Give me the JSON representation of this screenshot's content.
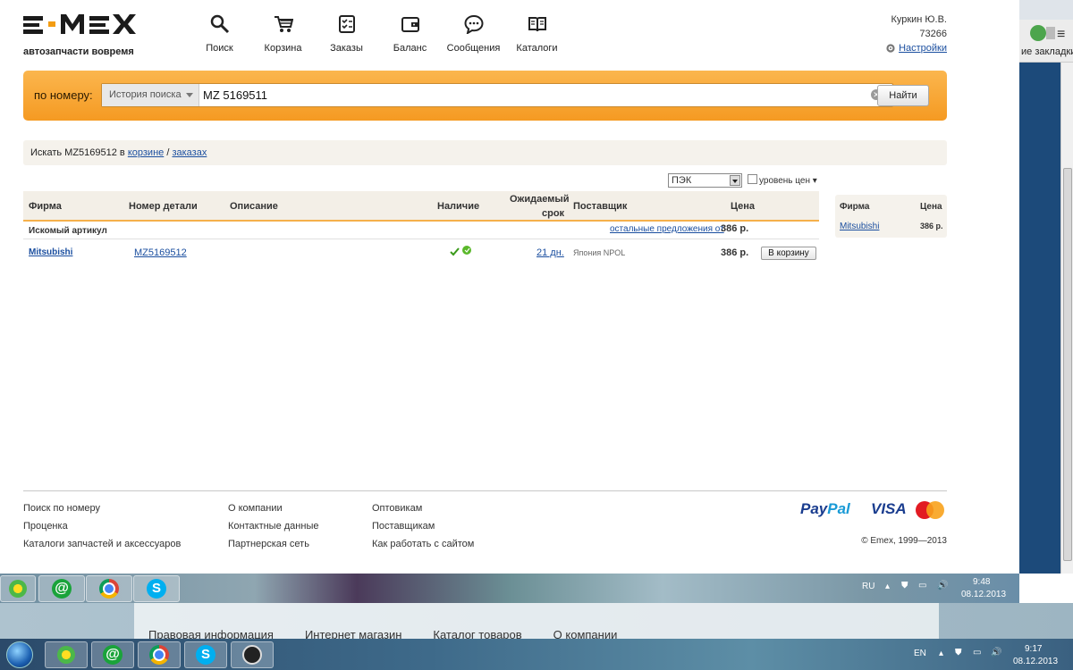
{
  "logo": {
    "text": "EMEX",
    "tagline": "автозапчасти вовремя"
  },
  "nav": [
    {
      "label": "Поиск",
      "icon": "search-icon"
    },
    {
      "label": "Корзина",
      "icon": "cart-icon"
    },
    {
      "label": "Заказы",
      "icon": "orders-icon"
    },
    {
      "label": "Баланс",
      "icon": "wallet-icon"
    },
    {
      "label": "Сообщения",
      "icon": "message-icon"
    },
    {
      "label": "Каталоги",
      "icon": "book-icon"
    }
  ],
  "user": {
    "name": "Куркин Ю.В.",
    "id": "73266",
    "settings_label": "Настройки"
  },
  "search": {
    "label": "по номеру:",
    "history_label": "История поиска",
    "query": "MZ 5169511",
    "button": "Найти"
  },
  "info": {
    "prefix": "Искать MZ5169512 в",
    "link_cart": "корзине",
    "separator": "/",
    "link_orders": "заказах"
  },
  "filter": {
    "selected": "ПЭК",
    "price_level_label": "уровень цен"
  },
  "table": {
    "headers": {
      "brand": "Фирма",
      "part_number": "Номер детали",
      "description": "Описание",
      "availability": "Наличие",
      "expected_line1": "Ожидаемый",
      "expected_line2": "срок",
      "supplier": "Поставщик",
      "price": "Цена"
    },
    "searched_label": "Искомый артикул",
    "other_offers_label": "остальные предложения от",
    "other_offers_price": "386 р.",
    "rows": [
      {
        "brand": "Mitsubishi",
        "part_number": "MZ5169512",
        "description": "",
        "expected": "21 дн.",
        "supplier": "Япония NPOL",
        "price": "386 р.",
        "cart_button": "В корзину"
      }
    ]
  },
  "mini": {
    "header_brand": "Фирма",
    "header_price": "Цена",
    "brand": "Mitsubishi",
    "price": "386 р."
  },
  "footer": {
    "col1": [
      "Поиск по номеру",
      "Проценка",
      "Каталоги запчастей и аксессуаров"
    ],
    "col2": [
      "О компании",
      "Контактные данные",
      "Партнерская сеть"
    ],
    "col3": [
      "Оптовикам",
      "Поставщикам",
      "Как работать с сайтом"
    ],
    "paypal_pay": "Pay",
    "paypal_pal": "Pal",
    "visa": "VISA",
    "copyright": "© Emex, 1999—2013"
  },
  "browser": {
    "bookmarks_label": "ие закладки"
  },
  "taskbar1": {
    "lang": "RU",
    "time": "9:48",
    "date": "08.12.2013"
  },
  "midstrip": {
    "links": [
      "Правовая информация",
      "Интернет магазин",
      "Каталог товаров",
      "О компании"
    ]
  },
  "taskbar2": {
    "lang": "EN",
    "time": "9:17",
    "date": "08.12.2013"
  },
  "colors": {
    "accent": "#f59a22",
    "link": "#1a4e9f",
    "table_header_bg": "#f3efe7"
  }
}
